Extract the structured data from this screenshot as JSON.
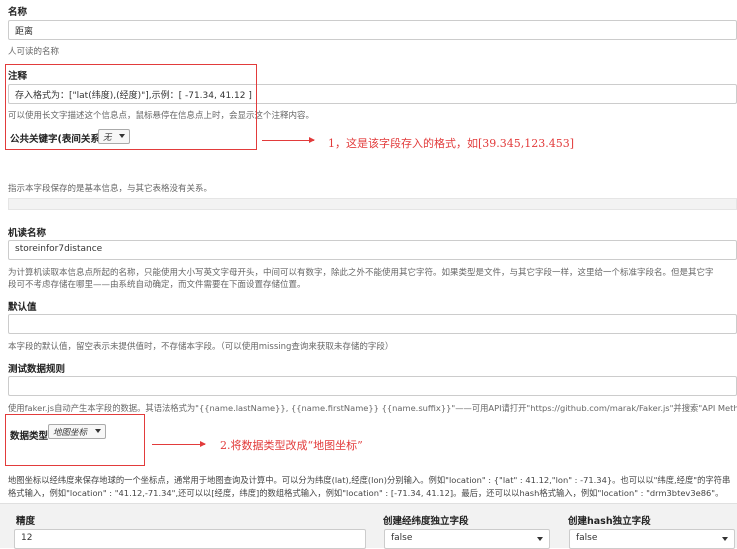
{
  "name_field": {
    "label": "名称",
    "value": "距离",
    "help": "人可读的名称"
  },
  "comment_field": {
    "label": "注释",
    "value": "存入格式为：[\"lat(纬度),(经度)\"],示例：[ -71.34, 41.12 ]",
    "help": "可以使用长文字描述这个信息点，鼠标悬停在信息点上时，会显示这个注释内容。"
  },
  "public_key": {
    "label": "公共关键字(表间关系)",
    "selected": "无"
  },
  "annotation_1": "1，这是该字段存入的格式，如[39.345,123.453]",
  "section_help": "指示本字段保存的是基本信息，与其它表格没有关系。",
  "machine_name": {
    "label": "机读名称",
    "value": "storeinfor7distance",
    "help_line1": "为计算机读取本信息点所起的名称，只能使用大小写英文字母开头，中间可以有数字，除此之外不能使用其它字符。如果类型是文件，与其它字段一样，这里给一个标准字段名。但是其它字",
    "help_line2": "段可不考虑存储在哪里——由系统自动确定，而文件需要在下面设置存储位置。"
  },
  "default_value": {
    "label": "默认值",
    "value": "",
    "help": "本字段的默认值，留空表示未提供值时，不存储本字段。（可以使用missing查询来获取未存储的字段）"
  },
  "test_rule": {
    "label": "测试数据规则",
    "value": "",
    "help": "使用faker.js自动产生本字段的数据。其语法格式为\"{{name.lastName}}, {{name.firstName}} {{name.suffix}}\"——可用API请打开\"https://github.com/marak/Faker.js\"并搜索\"API Methods\"。"
  },
  "data_type": {
    "label": "数据类型",
    "selected": "地图坐标"
  },
  "annotation_2": "2.将数据类型改成“地图坐标”",
  "geo_help_line1": "地图坐标以经纬度来保存地球的一个坐标点，通常用于地图查询及计算中。可以分为纬度(lat),经度(lon)分别输入。例如\"location\" : {\"lat\" : 41.12,\"lon\" : -71.34}。也可以以\"纬度,经度\"的字符串",
  "geo_help_line2": "格式输入，例如\"location\" : \"41.12,-71.34\",还可以以[经度，纬度]的数组格式输入，例如\"location\" : [-71.34, 41.12]。最后，还可以以hash格式输入，例如\"location\" : \"drm3btev3e86\"。",
  "precision": {
    "label": "精度",
    "value": "12"
  },
  "create_latlon": {
    "label": "创建经纬度独立字段",
    "selected": "false"
  },
  "create_hash": {
    "label": "创建hash独立字段",
    "selected": "false"
  },
  "colors": {
    "annotation": "#e23b3b"
  }
}
